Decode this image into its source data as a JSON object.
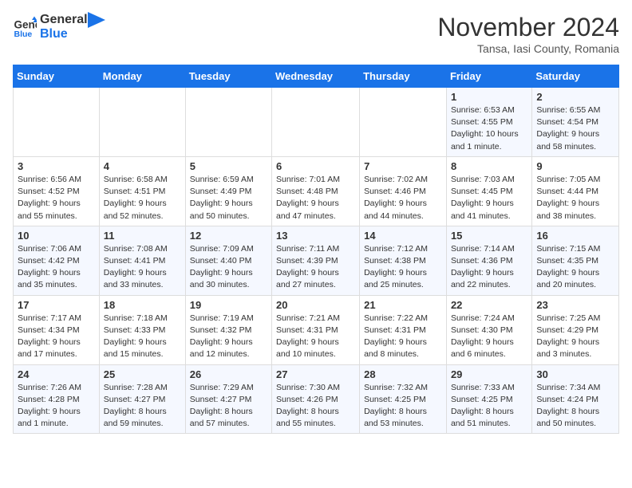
{
  "logo": {
    "line1": "General",
    "line2": "Blue"
  },
  "title": "November 2024",
  "location": "Tansa, Iasi County, Romania",
  "days_of_week": [
    "Sunday",
    "Monday",
    "Tuesday",
    "Wednesday",
    "Thursday",
    "Friday",
    "Saturday"
  ],
  "weeks": [
    [
      {
        "day": "",
        "info": ""
      },
      {
        "day": "",
        "info": ""
      },
      {
        "day": "",
        "info": ""
      },
      {
        "day": "",
        "info": ""
      },
      {
        "day": "",
        "info": ""
      },
      {
        "day": "1",
        "info": "Sunrise: 6:53 AM\nSunset: 4:55 PM\nDaylight: 10 hours\nand 1 minute."
      },
      {
        "day": "2",
        "info": "Sunrise: 6:55 AM\nSunset: 4:54 PM\nDaylight: 9 hours\nand 58 minutes."
      }
    ],
    [
      {
        "day": "3",
        "info": "Sunrise: 6:56 AM\nSunset: 4:52 PM\nDaylight: 9 hours\nand 55 minutes."
      },
      {
        "day": "4",
        "info": "Sunrise: 6:58 AM\nSunset: 4:51 PM\nDaylight: 9 hours\nand 52 minutes."
      },
      {
        "day": "5",
        "info": "Sunrise: 6:59 AM\nSunset: 4:49 PM\nDaylight: 9 hours\nand 50 minutes."
      },
      {
        "day": "6",
        "info": "Sunrise: 7:01 AM\nSunset: 4:48 PM\nDaylight: 9 hours\nand 47 minutes."
      },
      {
        "day": "7",
        "info": "Sunrise: 7:02 AM\nSunset: 4:46 PM\nDaylight: 9 hours\nand 44 minutes."
      },
      {
        "day": "8",
        "info": "Sunrise: 7:03 AM\nSunset: 4:45 PM\nDaylight: 9 hours\nand 41 minutes."
      },
      {
        "day": "9",
        "info": "Sunrise: 7:05 AM\nSunset: 4:44 PM\nDaylight: 9 hours\nand 38 minutes."
      }
    ],
    [
      {
        "day": "10",
        "info": "Sunrise: 7:06 AM\nSunset: 4:42 PM\nDaylight: 9 hours\nand 35 minutes."
      },
      {
        "day": "11",
        "info": "Sunrise: 7:08 AM\nSunset: 4:41 PM\nDaylight: 9 hours\nand 33 minutes."
      },
      {
        "day": "12",
        "info": "Sunrise: 7:09 AM\nSunset: 4:40 PM\nDaylight: 9 hours\nand 30 minutes."
      },
      {
        "day": "13",
        "info": "Sunrise: 7:11 AM\nSunset: 4:39 PM\nDaylight: 9 hours\nand 27 minutes."
      },
      {
        "day": "14",
        "info": "Sunrise: 7:12 AM\nSunset: 4:38 PM\nDaylight: 9 hours\nand 25 minutes."
      },
      {
        "day": "15",
        "info": "Sunrise: 7:14 AM\nSunset: 4:36 PM\nDaylight: 9 hours\nand 22 minutes."
      },
      {
        "day": "16",
        "info": "Sunrise: 7:15 AM\nSunset: 4:35 PM\nDaylight: 9 hours\nand 20 minutes."
      }
    ],
    [
      {
        "day": "17",
        "info": "Sunrise: 7:17 AM\nSunset: 4:34 PM\nDaylight: 9 hours\nand 17 minutes."
      },
      {
        "day": "18",
        "info": "Sunrise: 7:18 AM\nSunset: 4:33 PM\nDaylight: 9 hours\nand 15 minutes."
      },
      {
        "day": "19",
        "info": "Sunrise: 7:19 AM\nSunset: 4:32 PM\nDaylight: 9 hours\nand 12 minutes."
      },
      {
        "day": "20",
        "info": "Sunrise: 7:21 AM\nSunset: 4:31 PM\nDaylight: 9 hours\nand 10 minutes."
      },
      {
        "day": "21",
        "info": "Sunrise: 7:22 AM\nSunset: 4:31 PM\nDaylight: 9 hours\nand 8 minutes."
      },
      {
        "day": "22",
        "info": "Sunrise: 7:24 AM\nSunset: 4:30 PM\nDaylight: 9 hours\nand 6 minutes."
      },
      {
        "day": "23",
        "info": "Sunrise: 7:25 AM\nSunset: 4:29 PM\nDaylight: 9 hours\nand 3 minutes."
      }
    ],
    [
      {
        "day": "24",
        "info": "Sunrise: 7:26 AM\nSunset: 4:28 PM\nDaylight: 9 hours\nand 1 minute."
      },
      {
        "day": "25",
        "info": "Sunrise: 7:28 AM\nSunset: 4:27 PM\nDaylight: 8 hours\nand 59 minutes."
      },
      {
        "day": "26",
        "info": "Sunrise: 7:29 AM\nSunset: 4:27 PM\nDaylight: 8 hours\nand 57 minutes."
      },
      {
        "day": "27",
        "info": "Sunrise: 7:30 AM\nSunset: 4:26 PM\nDaylight: 8 hours\nand 55 minutes."
      },
      {
        "day": "28",
        "info": "Sunrise: 7:32 AM\nSunset: 4:25 PM\nDaylight: 8 hours\nand 53 minutes."
      },
      {
        "day": "29",
        "info": "Sunrise: 7:33 AM\nSunset: 4:25 PM\nDaylight: 8 hours\nand 51 minutes."
      },
      {
        "day": "30",
        "info": "Sunrise: 7:34 AM\nSunset: 4:24 PM\nDaylight: 8 hours\nand 50 minutes."
      }
    ]
  ]
}
